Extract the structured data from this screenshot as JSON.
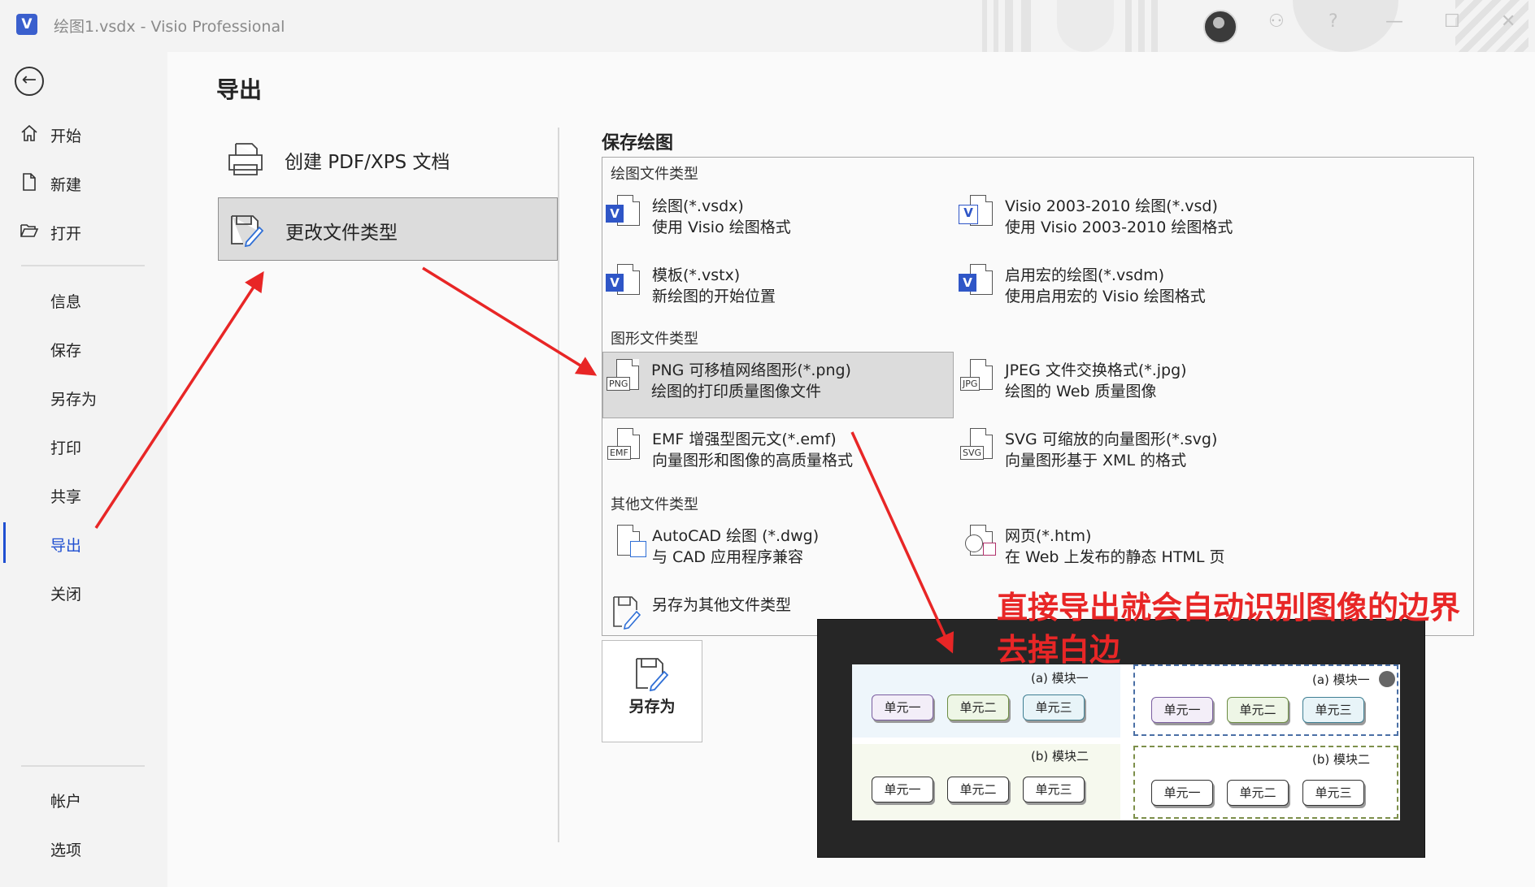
{
  "window": {
    "title": "绘图1.vsdx  -  Visio Professional",
    "app_letter": "V"
  },
  "sidebar": {
    "items": [
      {
        "label": "开始",
        "icon": "home-icon"
      },
      {
        "label": "新建",
        "icon": "new-file-icon"
      },
      {
        "label": "打开",
        "icon": "folder-open-icon"
      },
      {
        "label": "信息"
      },
      {
        "label": "保存"
      },
      {
        "label": "另存为"
      },
      {
        "label": "打印"
      },
      {
        "label": "共享"
      },
      {
        "label": "导出",
        "active": true
      },
      {
        "label": "关闭"
      },
      {
        "label": "帐户"
      },
      {
        "label": "选项"
      }
    ]
  },
  "main": {
    "title": "导出",
    "options": [
      {
        "label": "创建 PDF/XPS 文档"
      },
      {
        "label": "更改文件类型",
        "selected": true
      }
    ],
    "section_title": "保存绘图",
    "groups": [
      {
        "heading": "绘图文件类型"
      },
      {
        "heading": "图形文件类型"
      },
      {
        "heading": "其他文件类型"
      }
    ],
    "file_types": [
      {
        "name": "绘图(*.vsdx)",
        "desc": "使用 Visio 绘图格式"
      },
      {
        "name": "Visio 2003-2010 绘图(*.vsd)",
        "desc": "使用 Visio 2003-2010 绘图格式"
      },
      {
        "name": "模板(*.vstx)",
        "desc": "新绘图的开始位置"
      },
      {
        "name": "启用宏的绘图(*.vsdm)",
        "desc": "使用启用宏的 Visio 绘图格式"
      },
      {
        "name": "PNG 可移植网络图形(*.png)",
        "desc": "绘图的打印质量图像文件",
        "badge": "PNG",
        "selected": true
      },
      {
        "name": "JPEG 文件交换格式(*.jpg)",
        "desc": "绘图的 Web 质量图像",
        "badge": "JPG"
      },
      {
        "name": "EMF 增强型图元文(*.emf)",
        "desc": "向量图形和图像的高质量格式",
        "badge": "EMF"
      },
      {
        "name": "SVG 可缩放的向量图形(*.svg)",
        "desc": "向量图形基于 XML 的格式",
        "badge": "SVG"
      },
      {
        "name": "AutoCAD 绘图 (*.dwg)",
        "desc": "与 CAD 应用程序兼容"
      },
      {
        "name": "网页(*.htm)",
        "desc": "在 Web 上发布的静态 HTML 页"
      },
      {
        "name": "另存为其他文件类型",
        "desc": ""
      }
    ],
    "save_as_label": "另存为"
  },
  "annotation": {
    "line1": "直接导出就会自动识别图像的边界",
    "line2": "去掉白边",
    "color": "#e82626"
  },
  "preview": {
    "modules": [
      {
        "title": "(a)  模块一",
        "units": [
          "单元一",
          "单元二",
          "单元三"
        ]
      },
      {
        "title": "(a)  模块一",
        "units": [
          "单元一",
          "单元二",
          "单元三"
        ]
      },
      {
        "title": "(b)  模块二",
        "units": [
          "单元一",
          "单元二",
          "单元三"
        ]
      },
      {
        "title": "(b)  模块二",
        "units": [
          "单元一",
          "单元二",
          "单元三"
        ]
      }
    ]
  },
  "colors": {
    "accent": "#1f4fd1",
    "visio_blue": "#2f56c7",
    "arrow_red": "#e82626"
  }
}
